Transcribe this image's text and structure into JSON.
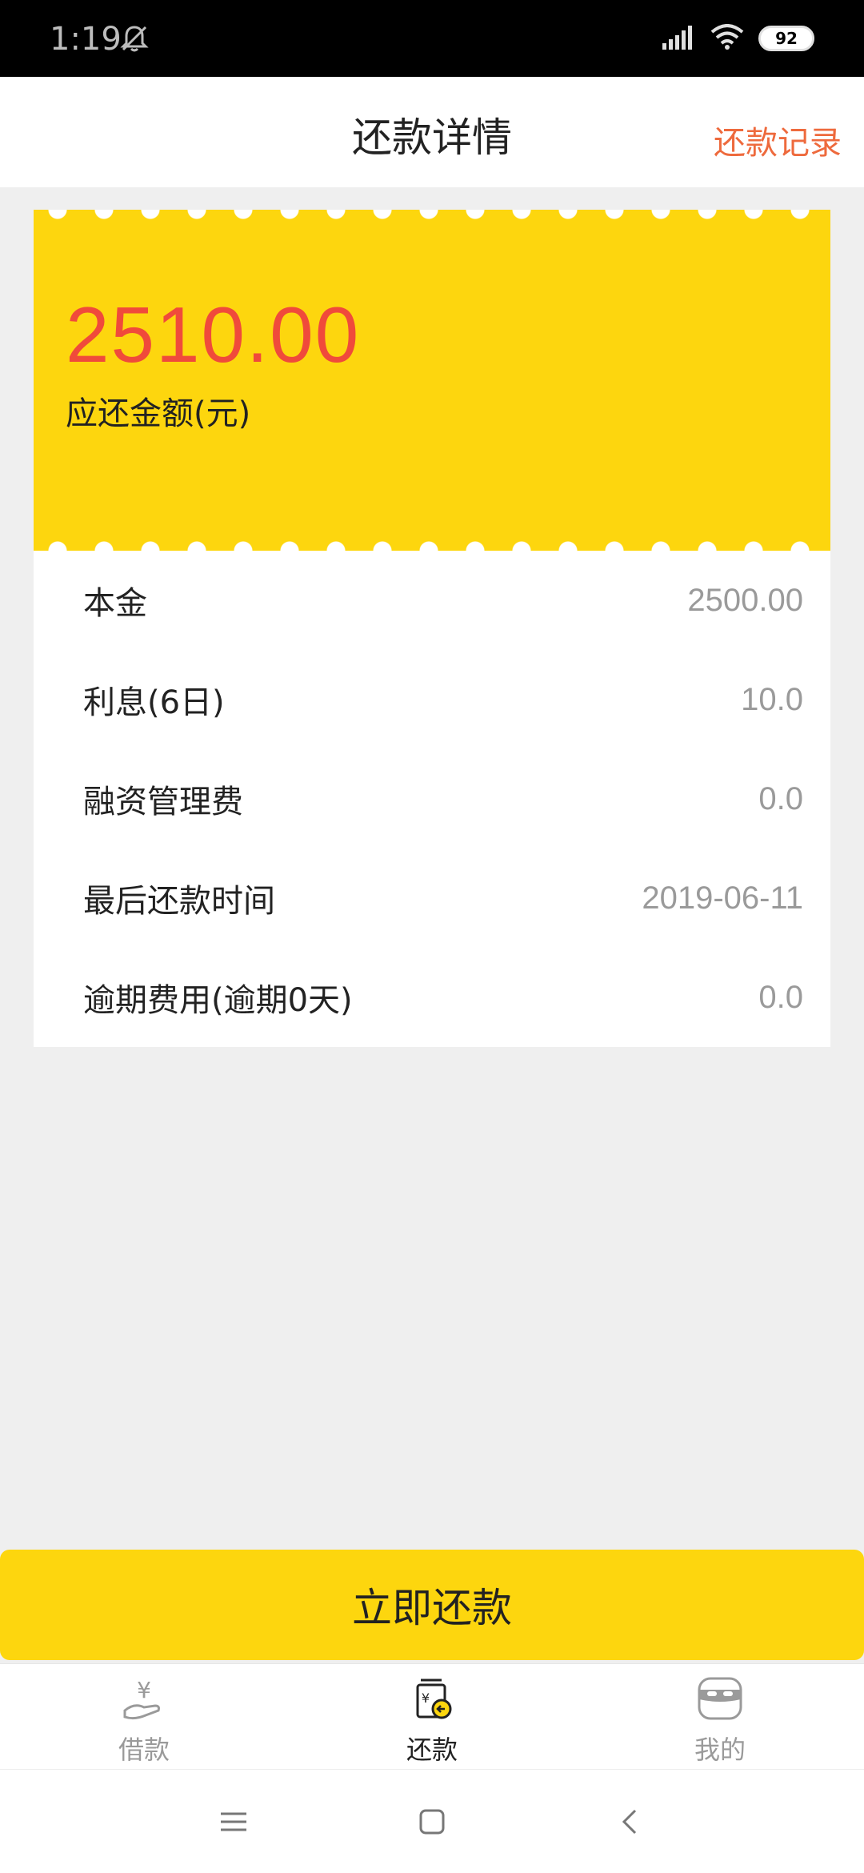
{
  "status_bar": {
    "time": "1:19",
    "battery": "92"
  },
  "header": {
    "title": "还款详情",
    "history_link": "还款记录"
  },
  "summary": {
    "amount": "2510.00",
    "amount_label": "应还金额(元)"
  },
  "details": [
    {
      "label": "本金",
      "value": "2500.00"
    },
    {
      "label": "利息(6日)",
      "value": "10.0"
    },
    {
      "label": "融资管理费",
      "value": "0.0"
    },
    {
      "label": "最后还款时间",
      "value": "2019-06-11"
    },
    {
      "label": "逾期费用(逾期0天)",
      "value": "0.0"
    }
  ],
  "action": {
    "repay_label": "立即还款"
  },
  "bottom_nav": {
    "items": [
      {
        "label": "借款",
        "icon": "loan-icon"
      },
      {
        "label": "还款",
        "icon": "repay-icon"
      },
      {
        "label": "我的",
        "icon": "profile-icon"
      }
    ],
    "active_index": 1
  },
  "colors": {
    "accent": "#fdd60e",
    "amount": "#f04a3b",
    "link": "#ee6a3d"
  }
}
